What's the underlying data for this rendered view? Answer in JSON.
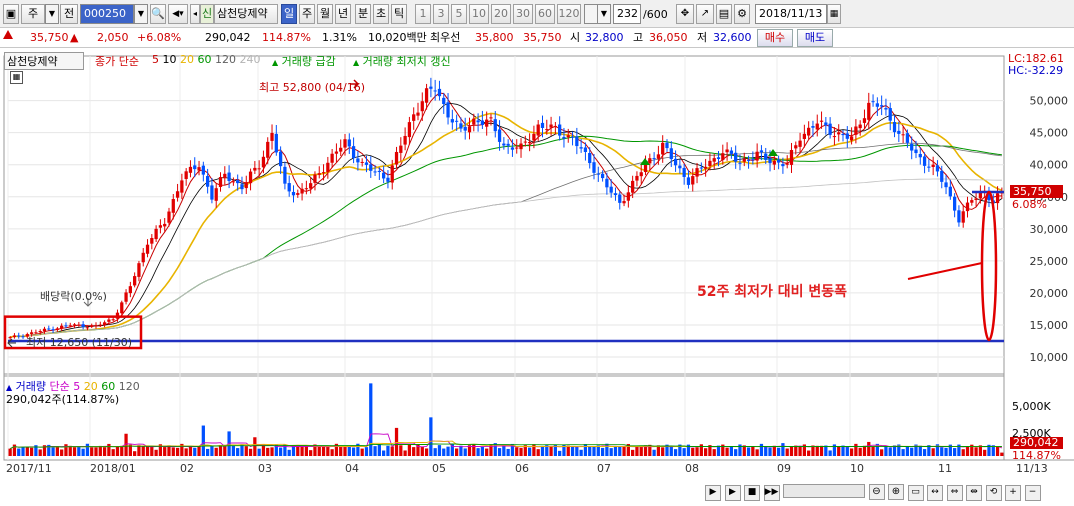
{
  "toolbar": {
    "market_label": "주",
    "period_label": "전",
    "code_value": "000250",
    "stock_new_badge": "신",
    "stock_name": "삼천당제약",
    "timeframes": [
      "일",
      "주",
      "월",
      "년",
      "분",
      "초",
      "틱"
    ],
    "active_timeframe": "일",
    "minute_options": [
      "1",
      "3",
      "5",
      "10",
      "20",
      "30",
      "60",
      "120"
    ],
    "count_value": "232",
    "count_total": "/600",
    "date_value": "2018/11/13"
  },
  "quote": {
    "price": "35,750",
    "change_arrow": "▲",
    "change": "2,050",
    "change_pct": "+6.08%",
    "volume": "290,042",
    "volume_ratio": "114.87%",
    "turnover_pct": "1.31%",
    "amount": "10,020백만",
    "best_bid_label": "최우선",
    "best_ask": "35,800",
    "best_bid": "35,750",
    "open_label": "시",
    "open": "32,800",
    "high_label": "고",
    "high": "36,050",
    "low_label": "저",
    "low": "32,600",
    "buy_label": "매수",
    "sell_label": "매도"
  },
  "legend": {
    "stock_tag": "삼천당제약",
    "ma_title": "종가 단순",
    "ma_periods": [
      "5",
      "10",
      "20",
      "60",
      "120",
      "240"
    ],
    "ma_colors": [
      "#c80000",
      "#000000",
      "#e8b400",
      "#009600",
      "#606060",
      "#b4b4b4"
    ],
    "signal1": "거래량 급감",
    "signal2": "거래량 최저치 갱신",
    "lc": "LC:182.61",
    "hc": "HC:-32.29"
  },
  "annotations": {
    "high_label": "최고 52,800 (04/16)",
    "low_label": "최저 12,650 (11/30)",
    "dividend_label": "배당락(0.0%)",
    "range_label": "52주 최저가 대비 변동폭",
    "current_price_tag": "35,750",
    "current_pct_tag": "6.08%"
  },
  "volume_legend": {
    "title": "거래량",
    "ma_title": "단순",
    "ma_periods": [
      "5",
      "20",
      "60",
      "120"
    ],
    "ma_colors": [
      "#c800c8",
      "#e8b400",
      "#009600",
      "#606060"
    ],
    "value": "290,042주(114.87%)",
    "axis": [
      "5,000K",
      "2,500K"
    ],
    "tag_value": "290,042",
    "tag_pct": "114.87%"
  },
  "chart_data": {
    "type": "candlestick",
    "price_axis": {
      "ticks": [
        10000,
        15000,
        20000,
        25000,
        30000,
        35000,
        40000,
        45000,
        50000
      ],
      "labels": [
        "10,000",
        "15,000",
        "20,000",
        "25,000",
        "30,000",
        "35,000",
        "40,000",
        "45,000",
        "50,000"
      ],
      "range": [
        8600,
        55400
      ]
    },
    "x_labels": [
      "2017/11",
      "2018/01",
      "02",
      "03",
      "04",
      "05",
      "06",
      "07",
      "08",
      "09",
      "10",
      "11",
      "11/13"
    ],
    "close_anchors": [
      [
        0,
        13000
      ],
      [
        8,
        14200
      ],
      [
        14,
        15000
      ],
      [
        20,
        14800
      ],
      [
        24,
        16000
      ],
      [
        28,
        21000
      ],
      [
        32,
        28000
      ],
      [
        36,
        31000
      ],
      [
        40,
        38000
      ],
      [
        44,
        40000
      ],
      [
        47,
        35000
      ],
      [
        50,
        38500
      ],
      [
        54,
        36500
      ],
      [
        58,
        40000
      ],
      [
        61,
        45000
      ],
      [
        64,
        36500
      ],
      [
        67,
        35500
      ],
      [
        70,
        37000
      ],
      [
        74,
        40500
      ],
      [
        78,
        43500
      ],
      [
        82,
        40000
      ],
      [
        85,
        38800
      ],
      [
        88,
        38000
      ],
      [
        91,
        43000
      ],
      [
        94,
        48000
      ],
      [
        97,
        51000
      ],
      [
        99,
        52000
      ],
      [
        102,
        48000
      ],
      [
        105,
        45000
      ],
      [
        108,
        47000
      ],
      [
        112,
        46500
      ],
      [
        115,
        43000
      ],
      [
        119,
        42500
      ],
      [
        123,
        46000
      ],
      [
        127,
        45500
      ],
      [
        131,
        44000
      ],
      [
        135,
        40500
      ],
      [
        139,
        36500
      ],
      [
        142,
        34000
      ],
      [
        145,
        37000
      ],
      [
        148,
        40000
      ],
      [
        152,
        43000
      ],
      [
        155,
        40000
      ],
      [
        158,
        37500
      ],
      [
        162,
        40000
      ],
      [
        166,
        42000
      ],
      [
        170,
        40500
      ],
      [
        174,
        41500
      ],
      [
        178,
        40500
      ],
      [
        181,
        40000
      ],
      [
        184,
        44500
      ],
      [
        188,
        46500
      ],
      [
        192,
        45000
      ],
      [
        196,
        44000
      ],
      [
        200,
        49500
      ],
      [
        203,
        49000
      ],
      [
        207,
        45000
      ],
      [
        211,
        41500
      ],
      [
        215,
        39500
      ],
      [
        218,
        36500
      ],
      [
        221,
        31500
      ],
      [
        224,
        34500
      ],
      [
        227,
        36000
      ],
      [
        229,
        34000
      ],
      [
        231,
        35750
      ]
    ],
    "high_mark": {
      "label": "최고",
      "value": 52800,
      "date": "04/16"
    },
    "low_mark": {
      "label": "최저",
      "value": 12650,
      "date": "11/30"
    },
    "last": {
      "open": 32800,
      "high": 36050,
      "low": 32600,
      "close": 35750,
      "volume": 290042
    }
  }
}
